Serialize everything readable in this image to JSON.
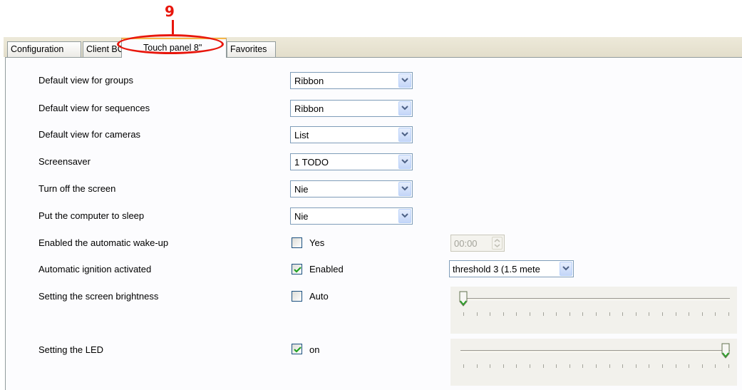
{
  "callout": {
    "number": "9"
  },
  "tabs": [
    {
      "label": "Configuration"
    },
    {
      "label": "Client BO"
    },
    {
      "label": "Touch panel 8\""
    },
    {
      "label": "Favorites"
    }
  ],
  "settings": {
    "groups": {
      "label": "Default view for groups",
      "value": "Ribbon"
    },
    "sequences": {
      "label": "Default view for sequences",
      "value": "Ribbon"
    },
    "cameras": {
      "label": "Default view for cameras",
      "value": "List"
    },
    "screensaver": {
      "label": "Screensaver",
      "value": "1 TODO"
    },
    "screen_off": {
      "label": "Turn off the screen",
      "value": "Nie"
    },
    "sleep": {
      "label": "Put the computer to sleep",
      "value": "Nie"
    },
    "wakeup": {
      "label": "Enabled the automatic wake-up",
      "checkbox_label": "Yes",
      "checked": false,
      "time": "00:00"
    },
    "ignition": {
      "label": "Automatic ignition activated",
      "checkbox_label": "Enabled",
      "checked": true,
      "threshold": "threshold 3 (1.5 mete"
    },
    "brightness": {
      "label": "Setting the screen brightness",
      "checkbox_label": "Auto",
      "checked": false,
      "level": 0.0,
      "ticks": 21
    },
    "led": {
      "label": "Setting the LED",
      "checkbox_label": "on",
      "checked": true,
      "level": 1.0,
      "ticks": 21
    }
  },
  "colors": {
    "callout": "#e8160c",
    "checkmark": "#21a121",
    "active_tab_accent": "#f5b64a"
  }
}
